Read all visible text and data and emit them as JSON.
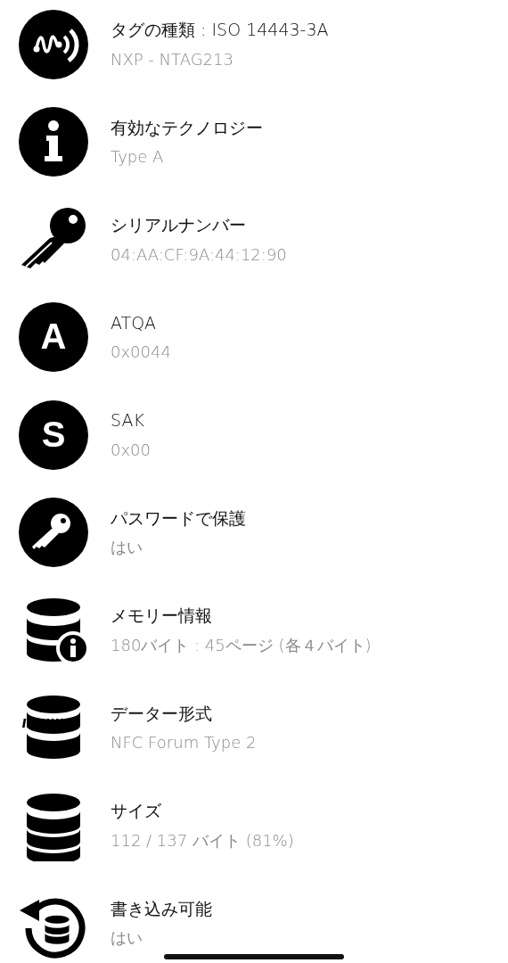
{
  "rows": [
    {
      "kind": "nfc",
      "title": "タグの種類 : ISO 14443-3A",
      "value": "NXP - NTAG213"
    },
    {
      "kind": "info",
      "title": "有効なテクノロジー",
      "value": "Type A"
    },
    {
      "kind": "key",
      "title": "シリアルナンバー",
      "value": "04:AA:CF:9A:44:12:90"
    },
    {
      "kind": "letter",
      "letter": "A",
      "title": "ATQA",
      "value": "0x0044"
    },
    {
      "kind": "letter",
      "letter": "S",
      "title": "SAK",
      "value": "0x00"
    },
    {
      "kind": "lock-key",
      "title": "パスワードで保護",
      "value": "はい"
    },
    {
      "kind": "db-info",
      "title": "メモリー情報",
      "value": "180バイト : 45ページ (各４バイト)"
    },
    {
      "kind": "db-format",
      "title": "データー形式",
      "value": "NFC Forum Type 2"
    },
    {
      "kind": "db",
      "title": "サイズ",
      "value": "112 / 137 バイト (81%)"
    },
    {
      "kind": "db-refresh",
      "title": "書き込み可能",
      "value": "はい"
    }
  ]
}
